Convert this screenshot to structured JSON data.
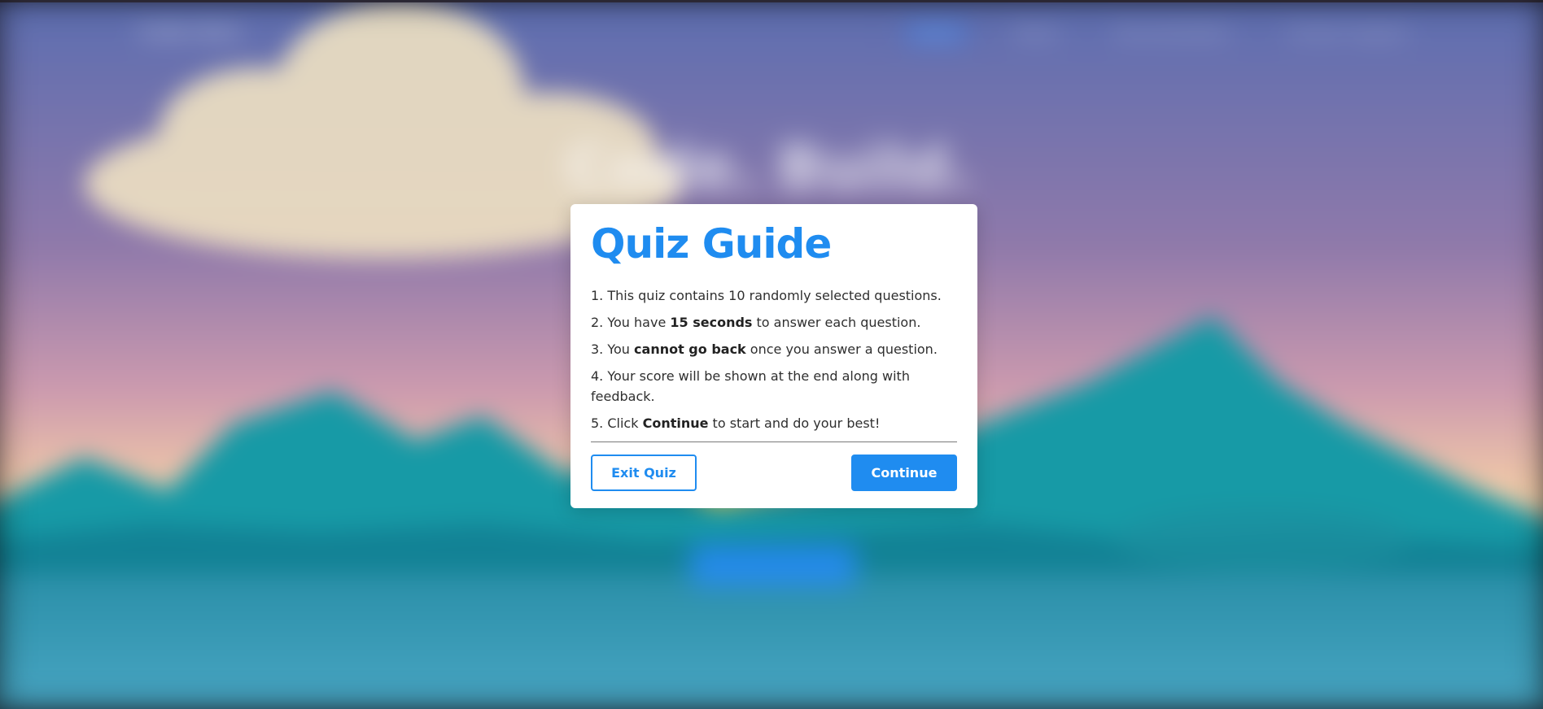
{
  "background": {
    "nav_logo": "Code Quiz",
    "nav_links": [
      "Home",
      "About",
      "Documentation",
      "Contact Support"
    ],
    "hero_title": "Code. Build.",
    "colors": {
      "sky_top": "#5b6fae",
      "sky_mid": "#b08bb0",
      "horizon": "#f1c6a6",
      "mountain": "#169aa4",
      "sea": "#3a9dbd"
    }
  },
  "modal": {
    "title": "Quiz Guide",
    "rules": [
      {
        "number": "1.",
        "before": "This quiz contains 10 randomly selected questions.",
        "bold": "",
        "after": ""
      },
      {
        "number": "2.",
        "before": "You have ",
        "bold": "15 seconds",
        "after": " to answer each question."
      },
      {
        "number": "3.",
        "before": "You ",
        "bold": "cannot go back",
        "after": " once you answer a question."
      },
      {
        "number": "4.",
        "before": "Your score will be shown at the end along with feedback.",
        "bold": "",
        "after": ""
      },
      {
        "number": "5.",
        "before": "Click ",
        "bold": "Continue",
        "after": " to start and do your best!"
      }
    ],
    "exit_label": "Exit Quiz",
    "continue_label": "Continue",
    "accent_color": "#1f8cf0"
  }
}
